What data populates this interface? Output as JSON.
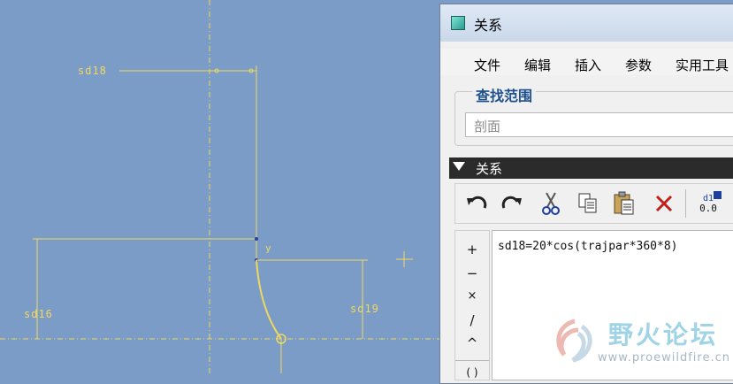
{
  "sketch": {
    "dimensions": {
      "top": "sd18",
      "left": "sd16",
      "right": "sd19"
    },
    "ref_label": "y"
  },
  "dialog": {
    "title": "关系",
    "menu": [
      "文件",
      "编辑",
      "插入",
      "参数",
      "实用工具"
    ],
    "search": {
      "legend": "查找范围",
      "value": "剖面"
    },
    "section": {
      "title": "关系"
    },
    "toolbar": {
      "icons": [
        "undo-icon",
        "redo-icon",
        "cut-icon",
        "copy-icon",
        "paste-icon",
        "delete-icon",
        "sort-relations-icon"
      ],
      "sort_label_top": "d1",
      "sort_label_bottom": "0.0"
    },
    "operators": [
      "+",
      "−",
      "×",
      "/",
      "^",
      "( )"
    ],
    "relation_text": "sd18=20*cos(trajpar*360*8)"
  },
  "watermark": {
    "text": "野火论坛",
    "url": "www.proewildfire.cn"
  },
  "colors": {
    "background": "#7b9cc6",
    "sketch": "#f0d860",
    "accent": "#1d4f8c"
  }
}
